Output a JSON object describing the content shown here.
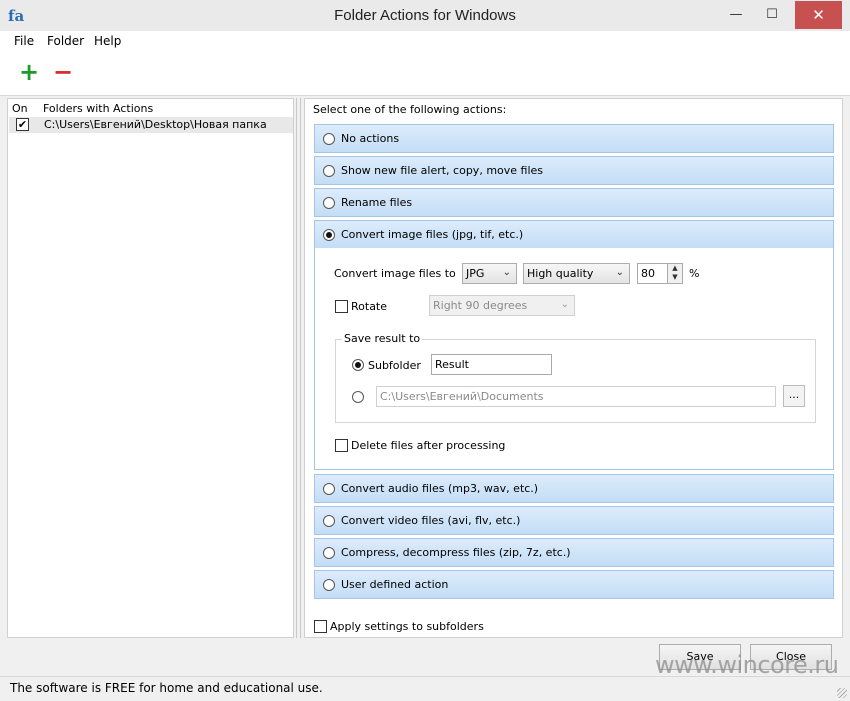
{
  "window": {
    "app_icon_text": "fa",
    "title": "Folder Actions for Windows",
    "minimize_glyph": "—",
    "maximize_glyph": "☐",
    "close_glyph": "✕"
  },
  "menu": [
    "File",
    "Folder",
    "Help"
  ],
  "toolbar": {
    "add_glyph": "+",
    "remove_glyph": "−",
    "add_icon": "add-folder-icon",
    "remove_icon": "remove-folder-icon"
  },
  "folders_list": {
    "col_on": "On",
    "col_folders": "Folders with Actions",
    "rows": [
      {
        "checked": true,
        "check_glyph": "✔",
        "path": "C:\\Users\\Евгений\\Desktop\\Новая папка"
      }
    ]
  },
  "actions": {
    "prompt": "Select one of the following actions:",
    "items": [
      {
        "label": "No actions",
        "selected": false
      },
      {
        "label": "Show new file alert, copy, move files",
        "selected": false
      },
      {
        "label": "Rename files",
        "selected": false
      },
      {
        "label": "Convert image files (jpg, tif, etc.)",
        "selected": true
      },
      {
        "label": "Convert audio files (mp3, wav, etc.)",
        "selected": false
      },
      {
        "label": "Convert video files (avi, flv, etc.)",
        "selected": false
      },
      {
        "label": "Compress, decompress files (zip, 7z, etc.)",
        "selected": false
      },
      {
        "label": "User defined action",
        "selected": false
      }
    ]
  },
  "convert_image": {
    "convert_label": "Convert image files to",
    "format_value": "JPG",
    "quality_value": "High quality",
    "quality_percent": "80",
    "percent_sign": "%",
    "rotate_label": "Rotate",
    "rotate_checked": false,
    "rotate_value": "Right 90 degrees",
    "save_result_title": "Save result to",
    "subfolder_label": "Subfolder",
    "subfolder_selected": true,
    "subfolder_value": "Result",
    "path_value": "C:\\Users\\Евгений\\Documents",
    "browse_label": "...",
    "delete_label": "Delete files after processing",
    "delete_checked": false
  },
  "apply_subfolders": {
    "label": "Apply settings to subfolders",
    "checked": false
  },
  "buttons": {
    "save": "Save",
    "close": "Close"
  },
  "status": "The software is FREE for home and educational use.",
  "watermark": "www.wincore.ru",
  "colors": {
    "action_bar": "#c9e0f8",
    "close_button": "#c75050",
    "add": "#1e9a2b",
    "remove": "#d92b2b"
  }
}
